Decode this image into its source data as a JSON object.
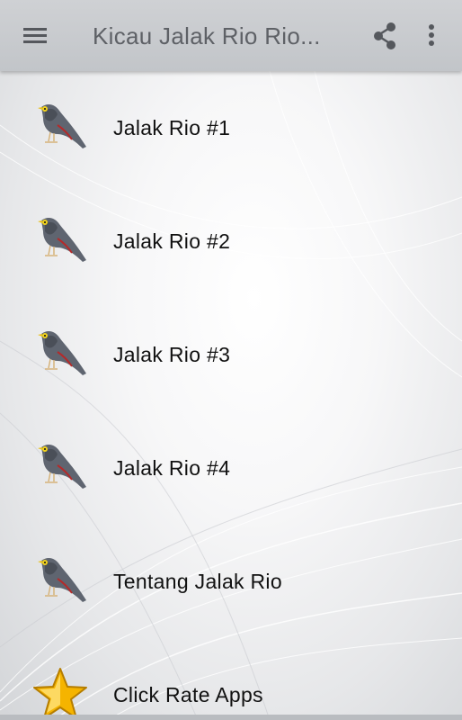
{
  "toolbar": {
    "title": "Kicau Jalak Rio Rio...",
    "menu_icon": "hamburger-menu-icon",
    "share_icon": "share-icon",
    "more_icon": "more-vertical-icon"
  },
  "items": [
    {
      "label": "Jalak Rio #1",
      "icon": "bird-icon"
    },
    {
      "label": "Jalak Rio #2",
      "icon": "bird-icon"
    },
    {
      "label": "Jalak Rio #3",
      "icon": "bird-icon"
    },
    {
      "label": "Jalak Rio #4",
      "icon": "bird-icon"
    },
    {
      "label": "Tentang Jalak Rio",
      "icon": "bird-icon"
    },
    {
      "label": "Click Rate Apps",
      "icon": "star-icon"
    }
  ],
  "colors": {
    "toolbar": "#c7c9cc",
    "toolbar_text": "#5e6166",
    "item_text": "#111111",
    "star": "#f5b400"
  }
}
